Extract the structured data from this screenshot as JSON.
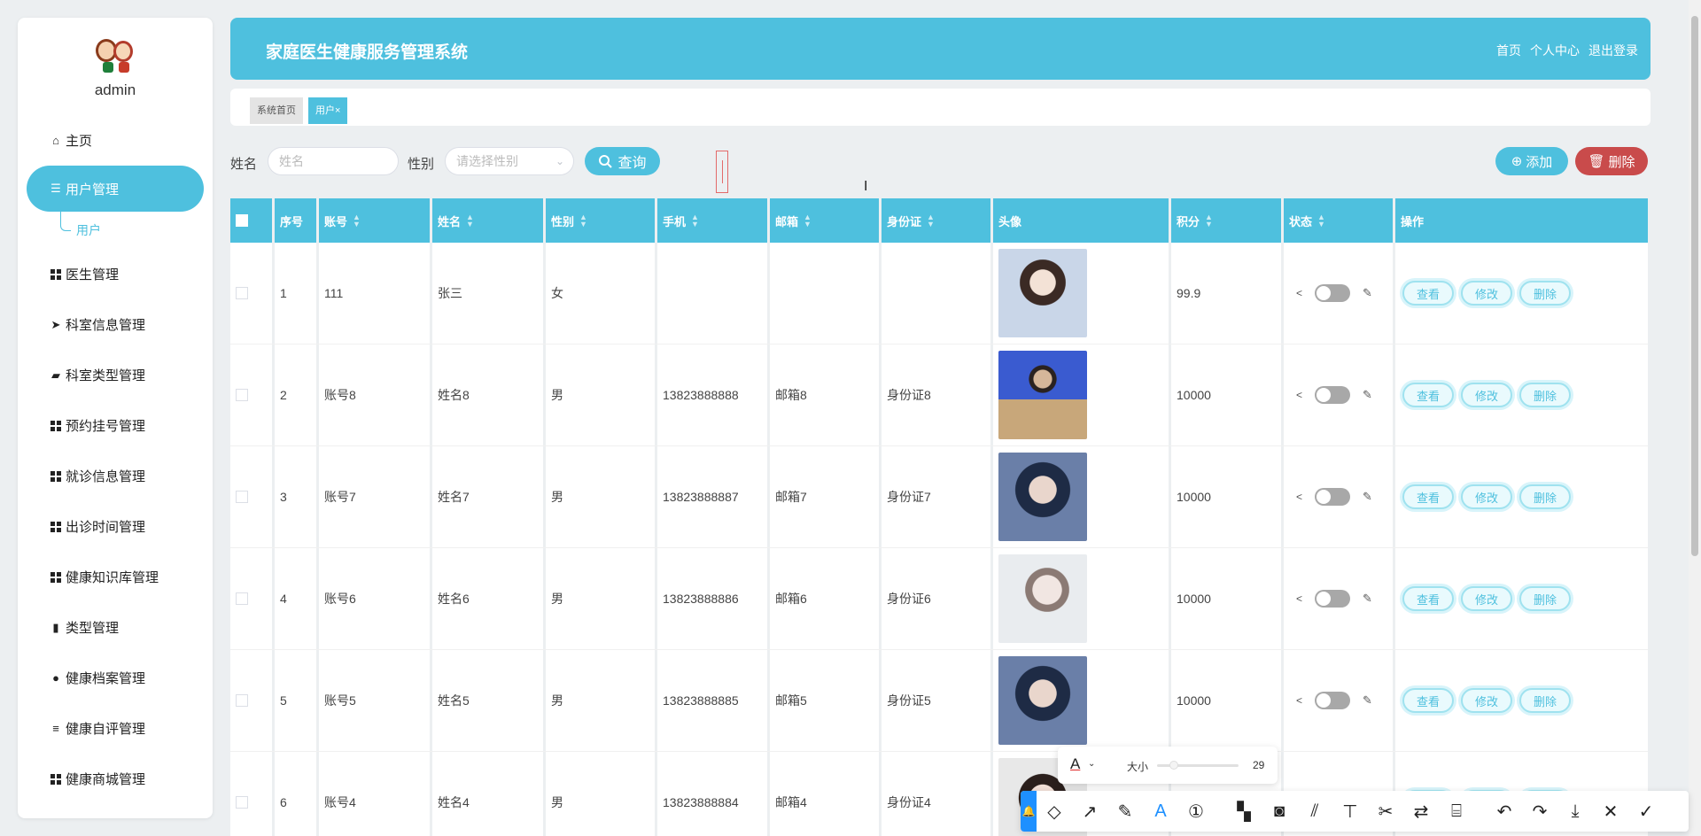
{
  "app": {
    "title": "家庭医生健康服务管理系统"
  },
  "header_links": [
    "首页",
    "个人中心",
    "退出登录"
  ],
  "user": {
    "name": "admin"
  },
  "sidebar": {
    "items": [
      {
        "label": "主页",
        "icon": "home-icon"
      },
      {
        "label": "用户管理",
        "icon": "list-icon",
        "active": true
      },
      {
        "label": "医生管理",
        "icon": "grid-icon"
      },
      {
        "label": "科室信息管理",
        "icon": "send-icon"
      },
      {
        "label": "科室类型管理",
        "icon": "wallet-icon"
      },
      {
        "label": "预约挂号管理",
        "icon": "grid-icon"
      },
      {
        "label": "就诊信息管理",
        "icon": "grid-icon"
      },
      {
        "label": "出诊时间管理",
        "icon": "grid-icon"
      },
      {
        "label": "健康知识库管理",
        "icon": "grid-icon"
      },
      {
        "label": "类型管理",
        "icon": "bar-chart-icon"
      },
      {
        "label": "健康档案管理",
        "icon": "person-icon"
      },
      {
        "label": "健康自评管理",
        "icon": "sliders-icon"
      },
      {
        "label": "健康商城管理",
        "icon": "grid-icon"
      }
    ],
    "sub_item": "用户"
  },
  "tabs": {
    "home": "系统首页",
    "current": "用户",
    "close": "×"
  },
  "filter": {
    "name_label": "姓名",
    "name_placeholder": "姓名",
    "gender_label": "性别",
    "gender_placeholder": "请选择性别",
    "query_label": "查询",
    "add_label": "添加",
    "delete_label": "删除"
  },
  "table": {
    "headers": [
      "序号",
      "账号",
      "姓名",
      "性别",
      "手机",
      "邮箱",
      "身份证",
      "头像",
      "积分",
      "状态",
      "操作"
    ],
    "rows": [
      {
        "idx": "1",
        "account": "111",
        "name": "张三",
        "gender": "女",
        "phone": "",
        "email": "",
        "idcard": "",
        "points": "99.9"
      },
      {
        "idx": "2",
        "account": "账号8",
        "name": "姓名8",
        "gender": "男",
        "phone": "13823888888",
        "email": "邮箱8",
        "idcard": "身份证8",
        "points": "10000"
      },
      {
        "idx": "3",
        "account": "账号7",
        "name": "姓名7",
        "gender": "男",
        "phone": "13823888887",
        "email": "邮箱7",
        "idcard": "身份证7",
        "points": "10000"
      },
      {
        "idx": "4",
        "account": "账号6",
        "name": "姓名6",
        "gender": "男",
        "phone": "13823888886",
        "email": "邮箱6",
        "idcard": "身份证6",
        "points": "10000"
      },
      {
        "idx": "5",
        "account": "账号5",
        "name": "姓名5",
        "gender": "男",
        "phone": "13823888885",
        "email": "邮箱5",
        "idcard": "身份证5",
        "points": "10000"
      },
      {
        "idx": "6",
        "account": "账号4",
        "name": "姓名4",
        "gender": "男",
        "phone": "13823888884",
        "email": "邮箱4",
        "idcard": "身份证4",
        "points": ""
      }
    ],
    "actions": {
      "view": "查看",
      "edit": "修改",
      "delete": "删除"
    }
  },
  "annotation": {
    "size_label": "大小",
    "size_value": "29",
    "tools": [
      "shape-icon",
      "arrow-icon",
      "pen-icon",
      "text-icon",
      "number-icon",
      "mosaic-icon",
      "blur-icon",
      "hatch-icon",
      "pin-icon",
      "scissors-icon",
      "translate-icon",
      "ocr-icon",
      "undo-icon",
      "redo-icon",
      "download-icon",
      "close-icon",
      "confirm-icon"
    ]
  },
  "colors": {
    "accent": "#4ec0de",
    "danger": "#c94b4b",
    "background": "#eceff1"
  }
}
